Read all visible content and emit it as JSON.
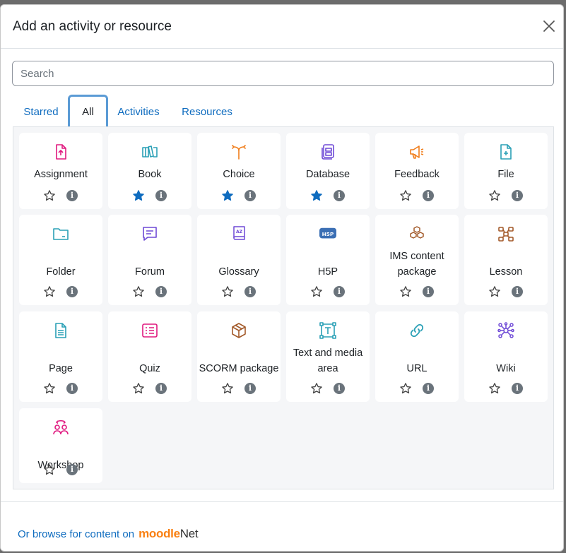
{
  "modal": {
    "title": "Add an activity or resource",
    "close_label": "×",
    "search_placeholder": "Search"
  },
  "tabs": [
    {
      "label": "Starred",
      "active": false
    },
    {
      "label": "All",
      "active": true
    },
    {
      "label": "Activities",
      "active": false
    },
    {
      "label": "Resources",
      "active": false
    }
  ],
  "colors": {
    "link": "#0f6cbf",
    "star_active": "#0f6cbf",
    "pink": "#e0187f",
    "teal": "#2aa0b6",
    "orange": "#f07d1a",
    "purple": "#6e49d6",
    "brown": "#a35a2a"
  },
  "items": [
    {
      "label": "Assignment",
      "icon": "assignment-icon",
      "starred": false
    },
    {
      "label": "Book",
      "icon": "book-icon",
      "starred": true
    },
    {
      "label": "Choice",
      "icon": "choice-icon",
      "starred": true
    },
    {
      "label": "Database",
      "icon": "database-icon",
      "starred": true
    },
    {
      "label": "Feedback",
      "icon": "feedback-icon",
      "starred": false
    },
    {
      "label": "File",
      "icon": "file-icon",
      "starred": false
    },
    {
      "label": "Folder",
      "icon": "folder-icon",
      "starred": false
    },
    {
      "label": "Forum",
      "icon": "forum-icon",
      "starred": false
    },
    {
      "label": "Glossary",
      "icon": "glossary-icon",
      "starred": false
    },
    {
      "label": "H5P",
      "icon": "h5p-icon",
      "starred": false
    },
    {
      "label": "IMS content package",
      "icon": "ims-package-icon",
      "starred": false
    },
    {
      "label": "Lesson",
      "icon": "lesson-icon",
      "starred": false
    },
    {
      "label": "Page",
      "icon": "page-icon",
      "starred": false
    },
    {
      "label": "Quiz",
      "icon": "quiz-icon",
      "starred": false
    },
    {
      "label": "SCORM package",
      "icon": "scorm-icon",
      "starred": false
    },
    {
      "label": "Text and media area",
      "icon": "text-media-icon",
      "starred": false
    },
    {
      "label": "URL",
      "icon": "url-icon",
      "starred": false
    },
    {
      "label": "Wiki",
      "icon": "wiki-icon",
      "starred": false
    },
    {
      "label": "Workshop",
      "icon": "workshop-icon",
      "starred": false
    }
  ],
  "footer": {
    "browse_text": "Or browse for content on",
    "brand_part1": "moodle",
    "brand_part2": "Net"
  }
}
